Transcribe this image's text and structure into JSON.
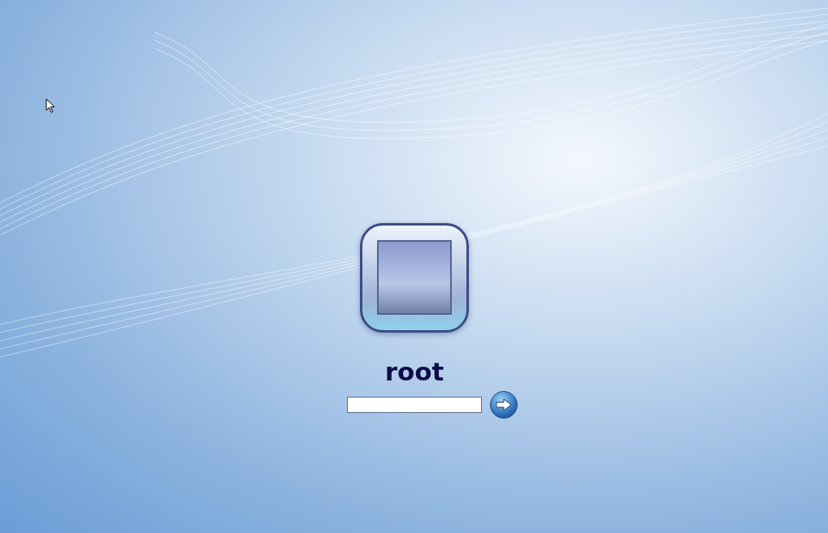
{
  "user": {
    "name": "root"
  }
}
